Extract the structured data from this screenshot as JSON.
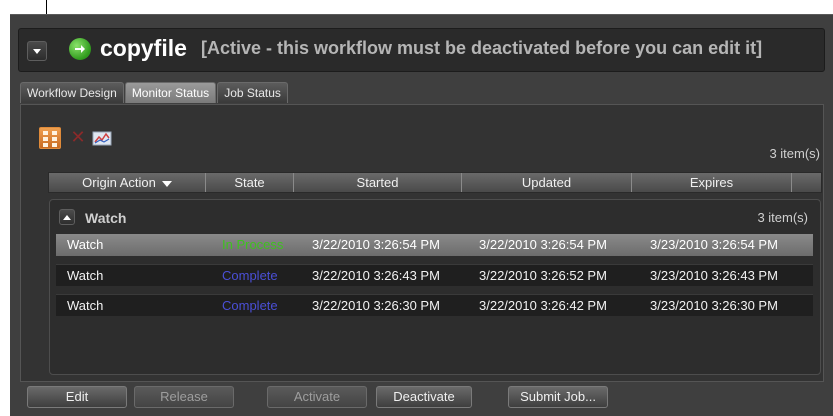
{
  "workflow": {
    "name": "copyfile",
    "status_text": "[Active - this workflow must be deactivated before you can edit it]"
  },
  "tabs": [
    {
      "label": "Workflow Design",
      "active": false
    },
    {
      "label": "Monitor Status",
      "active": true
    },
    {
      "label": "Job Status",
      "active": false
    }
  ],
  "toolbar": {
    "group_view_icon": "group-view-icon",
    "delete_icon": "delete-icon",
    "chart_icon": "chart-icon",
    "items_count": "3 item(s)"
  },
  "table": {
    "columns": [
      "Origin Action",
      "State",
      "Started",
      "Updated",
      "Expires"
    ],
    "group": {
      "label": "Watch",
      "count": "3 item(s)"
    },
    "rows": [
      {
        "origin": "Watch",
        "state": "In Process",
        "started": "3/22/2010 3:26:54 PM",
        "updated": "3/22/2010 3:26:54 PM",
        "expires": "3/23/2010 3:26:54 PM",
        "selected": true
      },
      {
        "origin": "Watch",
        "state": "Complete",
        "started": "3/22/2010 3:26:43 PM",
        "updated": "3/22/2010 3:26:52 PM",
        "expires": "3/23/2010 3:26:43 PM",
        "selected": false
      },
      {
        "origin": "Watch",
        "state": "Complete",
        "started": "3/22/2010 3:26:30 PM",
        "updated": "3/22/2010 3:26:42 PM",
        "expires": "3/23/2010 3:26:30 PM",
        "selected": false
      }
    ]
  },
  "buttons": {
    "edit": "Edit",
    "release": "Release",
    "activate": "Activate",
    "deactivate": "Deactivate",
    "submit_job": "Submit Job..."
  },
  "colors": {
    "state_in_process": "#3ec21e",
    "state_complete": "#4a4fd6",
    "go_icon": "#2f9a1c",
    "toolbar_active": "#e08b3a"
  }
}
